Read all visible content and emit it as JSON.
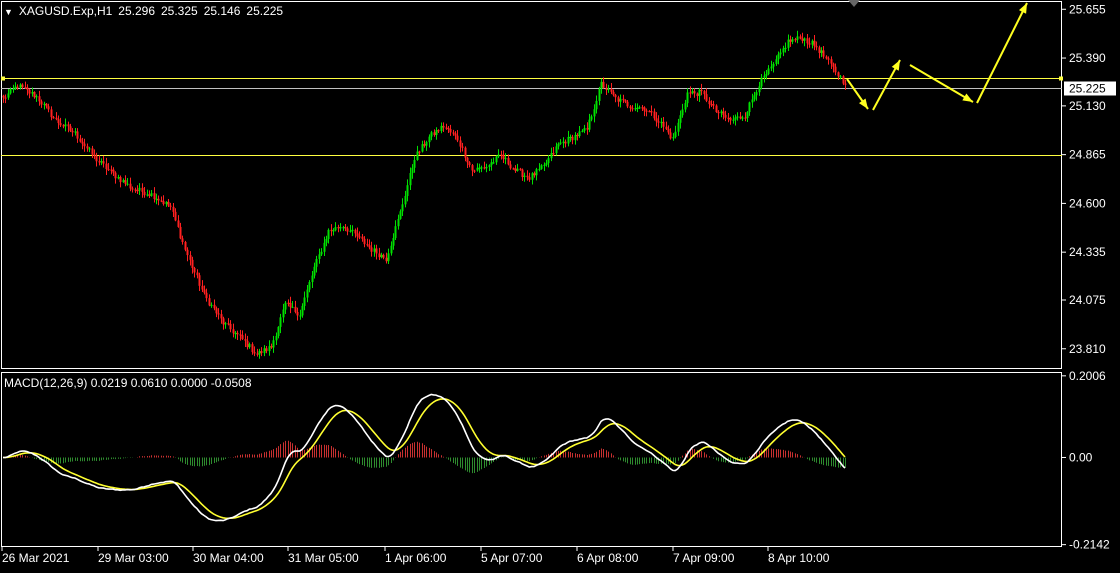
{
  "colors": {
    "background": "#000000",
    "axis": "#ffffff",
    "bull_candle": "#00e000",
    "bear_candle": "#ff2020",
    "level_line": "#ffff40",
    "bid_line": "#c0c0c0",
    "arrow": "#ffff20",
    "macd_line": "#ffffff",
    "signal_line": "#ffff30",
    "hist_positive": "#c83030",
    "hist_negative": "#2e8b2e"
  },
  "header": {
    "collapse_icon": "triangle-down-icon",
    "symbol": "XAGUSD.Exp,H1",
    "open": "25.296",
    "high": "25.325",
    "low": "25.146",
    "close": "25.225"
  },
  "indicator": {
    "label": "MACD(12,26,9) 0.0219 0.0610 0.0000 -0.0508"
  },
  "chart_data": [
    {
      "type": "candlestick",
      "title": "XAGUSD.Exp,H1",
      "ylim": [
        23.7,
        25.7
      ],
      "yticks": [
        "25.655",
        "25.390",
        "25.130",
        "24.865",
        "24.600",
        "24.335",
        "24.075",
        "23.810"
      ],
      "xticks": [
        "26 Mar 2021",
        "29 Mar 03:00",
        "30 Mar 04:00",
        "31 Mar 05:00",
        "1 Apr 06:00",
        "5 Apr 07:00",
        "6 Apr 08:00",
        "7 Apr 09:00",
        "8 Apr 10:00"
      ],
      "current_price": "25.225",
      "horizontal_levels": [
        25.28,
        24.865
      ],
      "close_anchors": [
        [
          0,
          25.17
        ],
        [
          6,
          25.24
        ],
        [
          14,
          25.18
        ],
        [
          22,
          25.05
        ],
        [
          30,
          24.98
        ],
        [
          38,
          24.85
        ],
        [
          46,
          24.76
        ],
        [
          54,
          24.68
        ],
        [
          62,
          24.65
        ],
        [
          70,
          24.58
        ],
        [
          76,
          24.35
        ],
        [
          84,
          24.1
        ],
        [
          92,
          23.95
        ],
        [
          100,
          23.86
        ],
        [
          106,
          23.78
        ],
        [
          112,
          23.82
        ],
        [
          118,
          24.05
        ],
        [
          124,
          24.0
        ],
        [
          130,
          24.25
        ],
        [
          136,
          24.45
        ],
        [
          142,
          24.48
        ],
        [
          148,
          24.42
        ],
        [
          154,
          24.35
        ],
        [
          160,
          24.3
        ],
        [
          166,
          24.55
        ],
        [
          172,
          24.85
        ],
        [
          178,
          24.96
        ],
        [
          184,
          25.02
        ],
        [
          190,
          24.95
        ],
        [
          196,
          24.78
        ],
        [
          202,
          24.8
        ],
        [
          208,
          24.86
        ],
        [
          214,
          24.78
        ],
        [
          220,
          24.74
        ],
        [
          226,
          24.8
        ],
        [
          232,
          24.92
        ],
        [
          238,
          24.96
        ],
        [
          244,
          25.0
        ],
        [
          250,
          25.25
        ],
        [
          256,
          25.17
        ],
        [
          262,
          25.13
        ],
        [
          268,
          25.12
        ],
        [
          274,
          25.05
        ],
        [
          280,
          24.95
        ],
        [
          286,
          25.2
        ],
        [
          292,
          25.2
        ],
        [
          298,
          25.1
        ],
        [
          304,
          25.05
        ],
        [
          310,
          25.08
        ],
        [
          316,
          25.25
        ],
        [
          322,
          25.35
        ],
        [
          328,
          25.48
        ],
        [
          334,
          25.5
        ],
        [
          340,
          25.45
        ],
        [
          346,
          25.35
        ],
        [
          352,
          25.25
        ]
      ],
      "bars_count": 353,
      "forecast_arrows": [
        [
          [
            847,
            79
          ],
          [
            868,
            109
          ]
        ],
        [
          [
            873,
            110
          ],
          [
            900,
            60
          ]
        ],
        [
          [
            910,
            65
          ],
          [
            973,
            102
          ]
        ],
        [
          [
            977,
            103
          ],
          [
            1027,
            3
          ]
        ]
      ]
    },
    {
      "type": "macd",
      "name": "MACD(12,26,9)",
      "params": [
        12,
        26,
        9
      ],
      "values": [
        0.0219,
        0.061,
        0.0,
        -0.0508
      ],
      "ylim": [
        -0.22,
        0.21
      ],
      "yticks": [
        "0.2006",
        "0.00",
        "-0.2142"
      ]
    }
  ]
}
